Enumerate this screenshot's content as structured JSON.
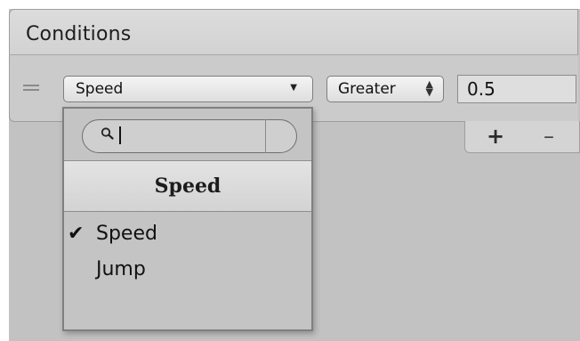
{
  "panel": {
    "title": "Conditions"
  },
  "condition_row": {
    "parameter": "Speed",
    "mode": "Greater",
    "value": "0.5"
  },
  "list_controls": {
    "add": "+",
    "remove": "–"
  },
  "dropdown_popup": {
    "search_value": "",
    "title": "Speed",
    "options": [
      {
        "label": "Speed",
        "selected": true
      },
      {
        "label": "Jump",
        "selected": false
      }
    ]
  },
  "glyphs": {
    "checkmark": "✔",
    "dropdown_arrow": "▼",
    "stepper_arrows": "▲▼"
  },
  "colors": {
    "canvas": "#c2c2c2",
    "header": "#d8d8d8",
    "popup": "#c4c4c4"
  }
}
